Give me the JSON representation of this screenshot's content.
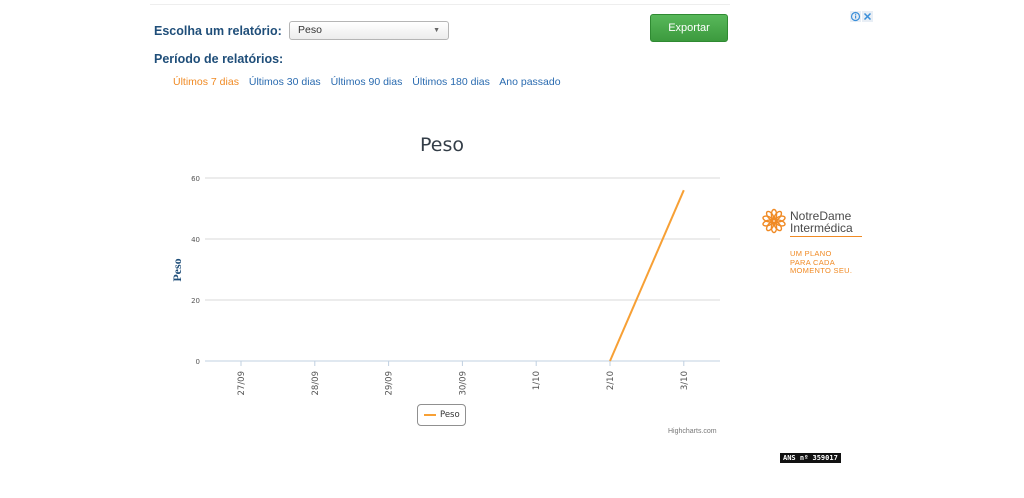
{
  "report": {
    "label": "Escolha um relatório:",
    "selected": "Peso",
    "export_label": "Exportar"
  },
  "period": {
    "label": "Período de relatórios:",
    "options": [
      "Últimos 7 dias",
      "Últimos 30 dias",
      "Últimos 90 dias",
      "Últimos 180 dias",
      "Ano passado"
    ],
    "active_index": 0
  },
  "chart_data": {
    "type": "line",
    "title": "Peso",
    "ylabel": "Peso",
    "xlabel": "",
    "categories": [
      "27/09",
      "28/09",
      "29/09",
      "30/09",
      "1/10",
      "2/10",
      "3/10"
    ],
    "series": [
      {
        "name": "Peso",
        "color": "#f7a035",
        "values": [
          null,
          null,
          null,
          null,
          null,
          0,
          56
        ]
      }
    ],
    "ylim": [
      0,
      60
    ],
    "yticks": [
      0,
      20,
      40,
      60
    ],
    "grid": true,
    "legend": "bottom-center",
    "credits": "Highcharts.com"
  },
  "ad": {
    "brand_line1": "NotreDame",
    "brand_line2": "Intermédica",
    "tagline": [
      "UM PLANO",
      "PARA CADA",
      "MOMENTO SEU."
    ],
    "ans": "ANS nº 359017",
    "accent": "#f08a24"
  }
}
